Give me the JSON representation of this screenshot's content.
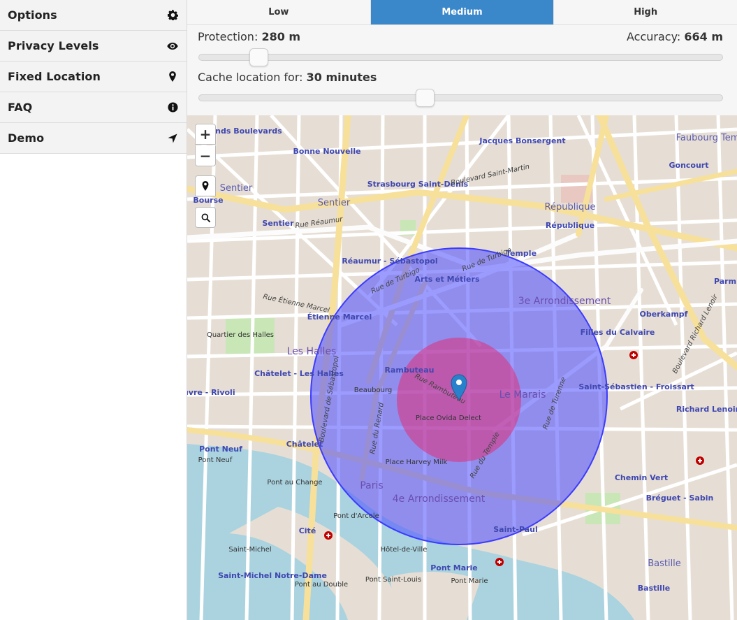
{
  "sidebar": {
    "items": [
      {
        "label": "Options",
        "icon": "gear-icon"
      },
      {
        "label": "Privacy Levels",
        "icon": "eye-icon"
      },
      {
        "label": "Fixed Location",
        "icon": "map-marker-icon"
      },
      {
        "label": "FAQ",
        "icon": "info-icon"
      },
      {
        "label": "Demo",
        "icon": "location-arrow-icon"
      }
    ]
  },
  "levels": {
    "tabs": [
      "Low",
      "Medium",
      "High"
    ],
    "active": "Medium"
  },
  "protection": {
    "label": "Protection:",
    "value": "280 m"
  },
  "accuracy": {
    "label": "Accuracy:",
    "value": "664 m"
  },
  "cache": {
    "label": "Cache location for:",
    "value": "30 minutes"
  },
  "sliders": {
    "protection_fraction": 0.1,
    "cache_fraction": 0.43
  },
  "map": {
    "zoom_in": "+",
    "zoom_out": "−",
    "labels": {
      "grands_boulevards": "Grands Boulevards",
      "bonne_nouvelle": "Bonne Nouvelle",
      "strasbourg_saint_denis": "Strasbourg Saint-Denis",
      "jacques_bonsergent": "Jacques Bonsergent",
      "faubourg_temple": "Faubourg Temple",
      "goncourt": "Goncourt",
      "republique": "République",
      "republique_station": "République",
      "sentier": "Sentier",
      "sentier_station": "Sentier",
      "bourse": "Bourse",
      "reaumur_sebastopol": "Réaumur - Sébastopol",
      "temple": "Temple",
      "arts_et_metiers": "Arts et Métiers",
      "arrondissement_3e": "3e Arrondissement",
      "oberkampf": "Oberkampf",
      "etienne_marcel": "Étienne Marcel",
      "filles_du_calvaire": "Filles du Calvaire",
      "les_halles": "Les Halles",
      "quartier_des_halles": "Quartier des Halles",
      "rambuteau": "Rambuteau",
      "beaubourg": "Beaubourg",
      "le_marais": "Le Marais",
      "chatelet_les_halles": "Châtelet - Les Halles",
      "saint_sebastien": "Saint-Sébastien - Froissart",
      "richard_lenoir": "Richard Lenoir",
      "louvre_rivoli": "Louvre - Rivoli",
      "place_ovida": "Place Ovida Delect",
      "chatelet": "Châtelet",
      "pont_neuf": "Pont Neuf",
      "pont_neuf_bridge": "Pont Neuf",
      "place_harvey_milk": "Place Harvey Milk",
      "paris": "Paris",
      "arrondissement_4e": "4e Arrondissement",
      "chemin_vert": "Chemin Vert",
      "breguet_sabin": "Bréguet - Sabin",
      "pont_au_change": "Pont au Change",
      "pont_darcole": "Pont d'Arcole",
      "cite": "Cité",
      "saint_paul": "Saint-Paul",
      "hotel_de_ville": "Hôtel-de-Ville",
      "saint_michel": "Saint-Michel",
      "saint_michel_notre_dame": "Saint-Michel Notre-Dame",
      "pont_marie": "Pont Marie",
      "pont_marie_bridge": "Pont Marie",
      "pont_saint_louis": "Pont Saint-Louis",
      "pont_au_double": "Pont au Double",
      "bastille": "Bastille",
      "bastille_station": "Bastille",
      "parm": "Parm",
      "rue_reaumur": "Rue Réaumur",
      "rue_de_turbigo": "Rue de Turbigo",
      "boulevard_saint_martin": "Boulevard Saint-Martin",
      "boulevard_sebastopol": "Boulevard de Sébastopol",
      "rue_du_renard": "Rue du Renard",
      "boulevard_richard_lenoir": "Boulevard Richard Lenoir",
      "rue_etienne_marcel": "Rue Étienne Marcel",
      "rue_rambuteau": "Rue Rambuteau",
      "rue_du_temple": "Rue du Temple",
      "rue_de_turenne": "Rue de Turenne"
    }
  },
  "colors": {
    "accent": "#3a87c9",
    "accuracy_circle": "#4b4bff",
    "protection_circle": "#e0307a",
    "water": "#aad3df",
    "marker": "#2a81cb"
  }
}
